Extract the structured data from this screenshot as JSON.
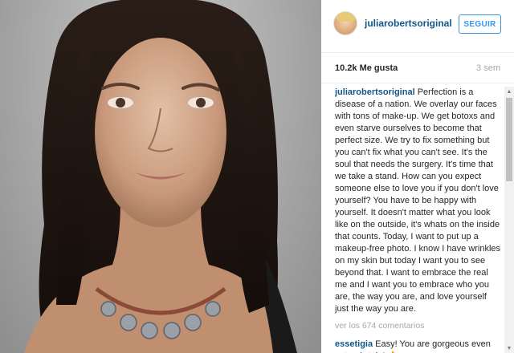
{
  "post": {
    "photo": {
      "description": "portrait-photo"
    },
    "header": {
      "username": "juliarobertsoriginal",
      "follow_label": "SEGUIR"
    },
    "meta": {
      "likes": "10.2k Me gusta",
      "time": "3 sem"
    },
    "caption": {
      "user": "juliarobertsoriginal",
      "text": " Perfection is a disease of a nation. We overlay our faces with tons of make-up. We get botoxs and even starve ourselves to become that perfect size. We try to fix something but you can't fix what you can't see. It's the soul that needs the surgery. It's time that we take a stand. How can you expect someone else to love you if you don't love yourself? You have to be happy with yourself. It doesn't matter what you look like on the outside, it's whats on the inside that counts. Today, I want to put up a makeup-free photo. I know I have wrinkles on my skin but today I want you to see beyond that. I want to embrace the real me and I want you to embrace who you are, the way you are, and love yourself just the way you are."
    },
    "view_all": "ver los 674 comentarios",
    "comments": [
      {
        "user": "essetigia",
        "text": " Easy! You are gorgeous even natural style! 👌"
      }
    ]
  },
  "icons": {
    "scroll_up": "scroll-up-arrow",
    "scroll_down": "scroll-down-arrow"
  },
  "colors": {
    "link": "#125688",
    "follow": "#3897f0",
    "muted": "#a5a7aa"
  }
}
